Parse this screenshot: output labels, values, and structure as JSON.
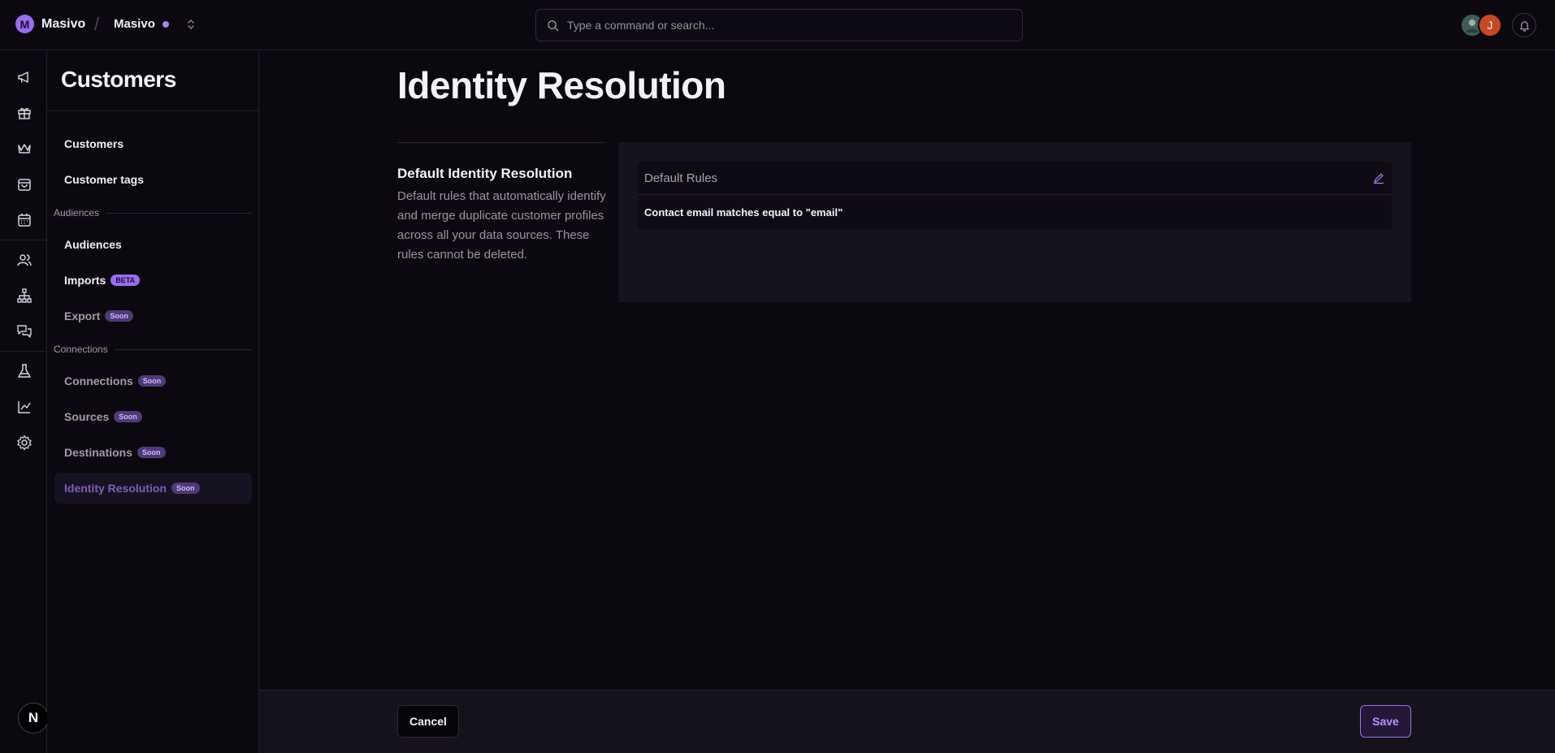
{
  "app": {
    "logo_letter": "M",
    "brand_name": "Masivo",
    "workspace_name": "Masivo",
    "accent_color": "#9b6bf0"
  },
  "search": {
    "placeholder": "Type a command or search..."
  },
  "user": {
    "avatar_2_initial": "J"
  },
  "rail": {
    "icons": [
      "megaphone-icon",
      "gift-icon",
      "crown-icon",
      "shopping-bag-icon",
      "calendar-icon",
      "users-icon",
      "hierarchy-icon",
      "chat-icon",
      "flask-icon",
      "line-chart-icon",
      "gear-icon"
    ],
    "bottom_badge": "N"
  },
  "sidebar": {
    "title": "Customers",
    "items": [
      {
        "label": "Customers"
      },
      {
        "label": "Customer tags"
      }
    ],
    "audiences_label": "Audiences",
    "audience_items": [
      {
        "label": "Audiences"
      },
      {
        "label": "Imports",
        "badge": "BETA"
      },
      {
        "label": "Export",
        "badge": "Soon"
      }
    ],
    "connections_label": "Connections",
    "connection_items": [
      {
        "label": "Connections",
        "badge": "Soon"
      },
      {
        "label": "Sources",
        "badge": "Soon"
      },
      {
        "label": "Destinations",
        "badge": "Soon"
      },
      {
        "label": "Identity Resolution",
        "badge": "Soon",
        "active": true
      }
    ]
  },
  "main": {
    "title": "Identity Resolution",
    "section_title": "Default Identity Resolution",
    "section_description": "Default rules that automatically identify and merge duplicate customer profiles across all your data sources. These rules cannot be deleted.",
    "rules_card": {
      "title": "Default Rules",
      "rule": "Contact email matches equal to \"email\""
    }
  },
  "footer": {
    "cancel_label": "Cancel",
    "save_label": "Save"
  }
}
